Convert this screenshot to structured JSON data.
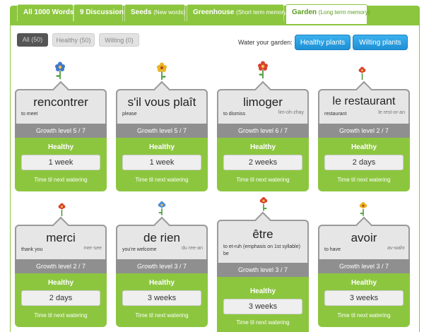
{
  "tabs": [
    {
      "label": "All 1000 Words",
      "sub": ""
    },
    {
      "label": "9 Discussions",
      "sub": ""
    },
    {
      "label": "Seeds",
      "sub": "(New words)"
    },
    {
      "label": "Greenhouse",
      "sub": "(Short term memory)"
    },
    {
      "label": "Garden",
      "sub": "(Long term memory)"
    }
  ],
  "filters": [
    {
      "label": "All (50)"
    },
    {
      "label": "Healthy (50)"
    },
    {
      "label": "Wilting (0)"
    }
  ],
  "water": {
    "label": "Water your garden:",
    "healthy_button": "Healthy plants",
    "wilting_button": "Wilting plants"
  },
  "colors": {
    "brand_green": "#8cc63f",
    "button_blue": "#1e90d6",
    "growth_gray": "#8f8f8f"
  },
  "cards": [
    {
      "word": "rencontrer",
      "meaning": "to meet",
      "pron": "",
      "growth": "Growth level 5 / 7",
      "health": "Healthy",
      "time": "1 week",
      "time_label": "Time til next watering",
      "flower": "blue-flower-icon"
    },
    {
      "word": "s'il vous plaît",
      "meaning": "please",
      "pron": "",
      "growth": "Growth level 5 / 7",
      "health": "Healthy",
      "time": "1 week",
      "time_label": "Time til next watering",
      "flower": "yellow-flower-icon"
    },
    {
      "word": "limoger",
      "meaning": "to dismiss",
      "pron": "lim-oh-zhay",
      "growth": "Growth level 6 / 7",
      "health": "Healthy",
      "time": "2 weeks",
      "time_label": "Time til next watering",
      "flower": "red-flower-icon"
    },
    {
      "word": "le restaurant",
      "meaning": "restaurant",
      "pron": "le rest-or-an",
      "growth": "Growth level 2 / 7",
      "health": "Healthy",
      "time": "2 days",
      "time_label": "Time til next watering",
      "flower": "red-sprout-icon"
    },
    {
      "word": "merci",
      "meaning": "thank you",
      "pron": "mer-see",
      "growth": "Growth level 2 / 7",
      "health": "Healthy",
      "time": "2 days",
      "time_label": "Time til next watering",
      "flower": "red-sprout-icon"
    },
    {
      "word": "de rien",
      "meaning": "you're welcome",
      "pron": "du ree-an",
      "growth": "Growth level 3 / 7",
      "health": "Healthy",
      "time": "3 weeks",
      "time_label": "Time til next watering",
      "flower": "blue-sprout-icon"
    },
    {
      "word": "être",
      "meaning": "to et-ruh (emphasis on 1st syllable)",
      "meaning2": "be",
      "pron": "",
      "growth": "Growth level 3 / 7",
      "health": "Healthy",
      "time": "3 weeks",
      "time_label": "Time til next watering",
      "flower": "red-sprout-icon"
    },
    {
      "word": "avoir",
      "meaning": "to have",
      "pron": "av-wahr",
      "growth": "Growth level 3 / 7",
      "health": "Healthy",
      "time": "3 weeks",
      "time_label": "Time til next watering",
      "flower": "yellow-sprout-icon"
    }
  ]
}
